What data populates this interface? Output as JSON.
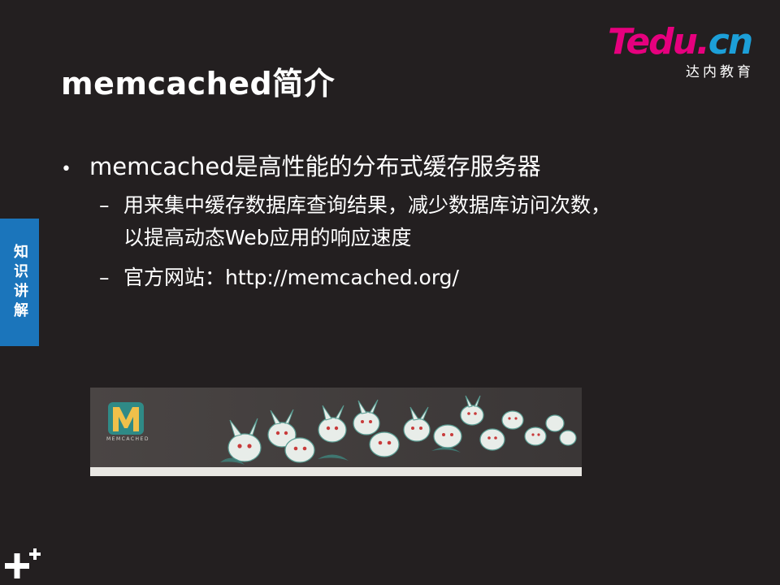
{
  "title": "memcached简介",
  "logo": {
    "wordmark_t": "T",
    "wordmark_rest": "edu",
    "wordmark_dot": ".",
    "wordmark_cn": "cn",
    "subtitle": "达内教育"
  },
  "sidetab": {
    "label": "知识讲解"
  },
  "bullets": {
    "main": "memcached是高性能的分布式缓存服务器",
    "sub1_line1": "用来集中缓存数据库查询结果，减少数据库访问次数，",
    "sub1_line2": "以提高动态Web应用的响应速度",
    "sub2": "官方网站：http://memcached.org/"
  },
  "banner": {
    "logo_text": "MEMCACHED"
  },
  "colors": {
    "background": "#231f20",
    "accent_blue": "#1b75bb",
    "logo_pink": "#e6007e",
    "logo_blue": "#1c9fd8"
  },
  "icons": {
    "corner": "plus-plus-icon",
    "bullet": "bullet-dot-icon",
    "dash": "dash-icon"
  }
}
